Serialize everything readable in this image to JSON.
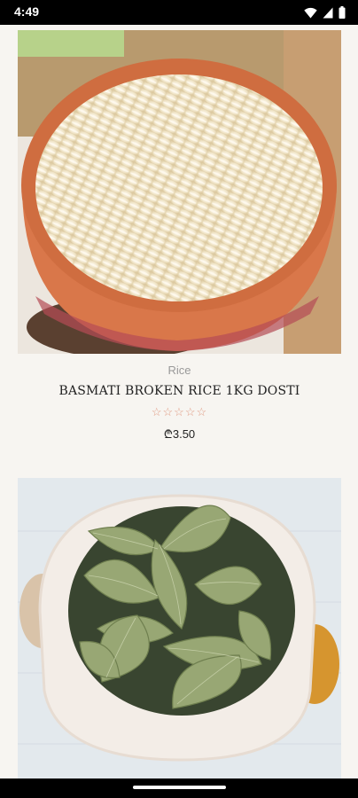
{
  "status_bar": {
    "time": "4:49"
  },
  "products": [
    {
      "image": "basmati-rice-bowl",
      "category": "Rice",
      "title": "BASMATI BROKEN RICE 1KG DOSTI",
      "rating_stars": "☆☆☆☆☆",
      "price": "₾3.50"
    },
    {
      "image": "bay-leaves-pot"
    }
  ]
}
